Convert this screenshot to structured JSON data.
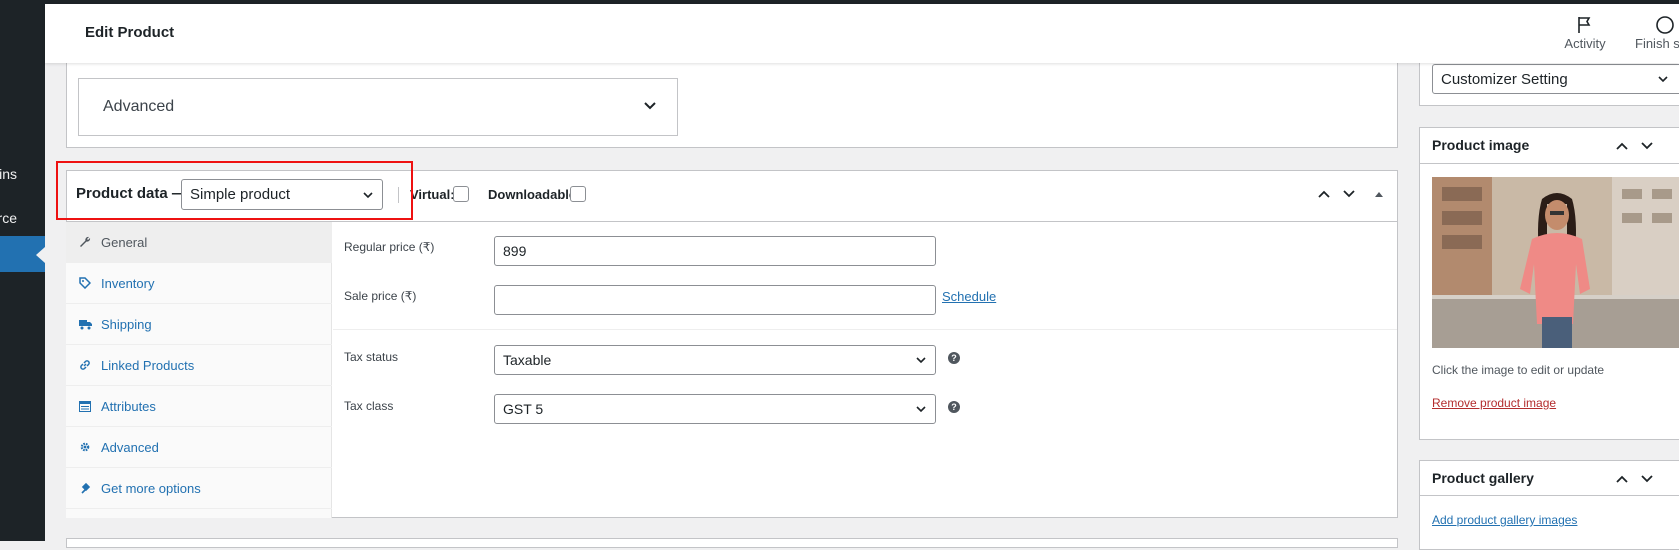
{
  "header": {
    "title": "Edit Product",
    "activity_label": "Activity",
    "finish_label": "Finish s"
  },
  "sidebar": {
    "items": [
      {
        "label": "ins"
      },
      {
        "label": "rce"
      }
    ]
  },
  "advanced_section": {
    "label": "Advanced"
  },
  "product_data": {
    "title": "Product data —",
    "type_selected": "Simple product",
    "virtual_label": "Virtual:",
    "downloadable_label": "Downloadable:"
  },
  "tabs": [
    {
      "label": "General",
      "icon": "wrench-icon"
    },
    {
      "label": "Inventory",
      "icon": "tag-icon"
    },
    {
      "label": "Shipping",
      "icon": "truck-icon"
    },
    {
      "label": "Linked Products",
      "icon": "link-icon"
    },
    {
      "label": "Attributes",
      "icon": "table-icon"
    },
    {
      "label": "Advanced",
      "icon": "gear-icon"
    },
    {
      "label": "Get more options",
      "icon": "plugin-icon"
    }
  ],
  "general": {
    "regular_price_label": "Regular price (₹)",
    "regular_price_value": "899",
    "sale_price_label": "Sale price (₹)",
    "sale_price_value": "",
    "schedule_link": "Schedule",
    "tax_status_label": "Tax status",
    "tax_status_value": "Taxable",
    "tax_class_label": "Tax class",
    "tax_class_value": "GST 5"
  },
  "right_panel": {
    "template_select": "Customizer Setting",
    "product_image_title": "Product image",
    "image_hint": "Click the image to edit or update",
    "remove_image_link": "Remove product image",
    "gallery_title": "Product gallery",
    "add_gallery_link": "Add product gallery images"
  },
  "colors": {
    "accent": "#2271b1",
    "sidebar": "#1d2327",
    "highlight": "#ee1111",
    "remove_link": "#b32d2e"
  }
}
